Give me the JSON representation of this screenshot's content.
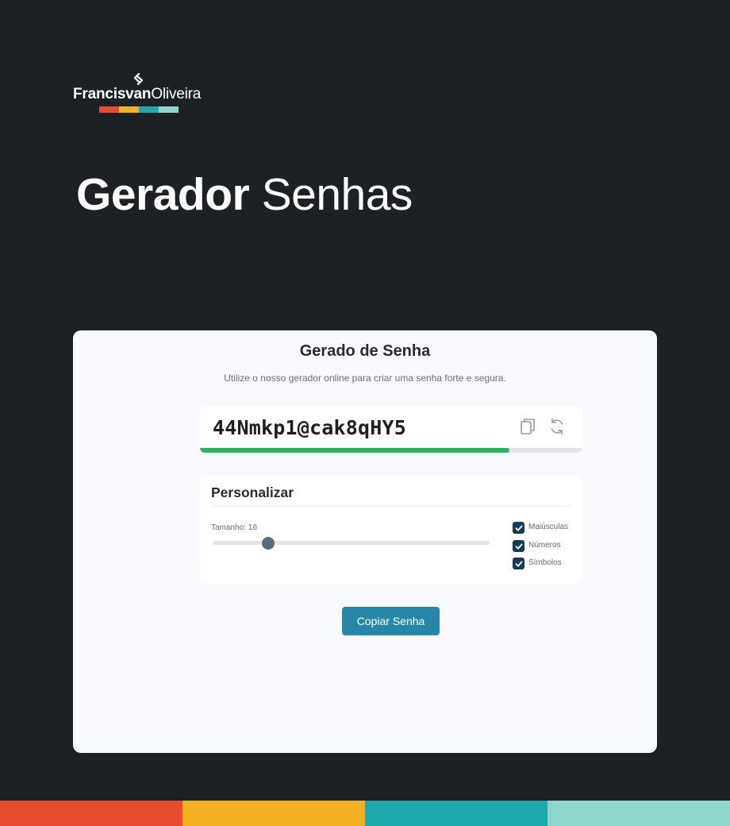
{
  "brand": {
    "name_bold": "Francisvan",
    "name_regular": "Oliveira",
    "logo_icon": "chevron-mark-icon",
    "colors": [
      "#e84c2f",
      "#f5b022",
      "#1fa9ad",
      "#8dd7ca"
    ]
  },
  "hero": {
    "title_bold": "Gerador",
    "title_light": "Senhas"
  },
  "card": {
    "title": "Gerado de Senha",
    "subtitle": "Utilize o nosso gerador online para criar uma senha forte e segura."
  },
  "password": {
    "value": "44Nmkp1@cak8qHY5",
    "strength": 0.81,
    "strength_color": "#28b463",
    "copy_icon": "copy-icon",
    "refresh_icon": "refresh-icon"
  },
  "customize": {
    "title": "Personalizar",
    "length_label": "Tamanho:",
    "length_value": "16",
    "length_min": 4,
    "length_max": 64,
    "options": [
      {
        "label": "Maiúsculas",
        "checked": true
      },
      {
        "label": "Números",
        "checked": true
      },
      {
        "label": "Símbolos",
        "checked": true
      }
    ]
  },
  "actions": {
    "copy_label": "Copiar Senha"
  },
  "colors": {
    "background": "#1d2024",
    "card": "#f7f9fc",
    "accent": "#2887a8",
    "checkbox": "#163c54"
  }
}
